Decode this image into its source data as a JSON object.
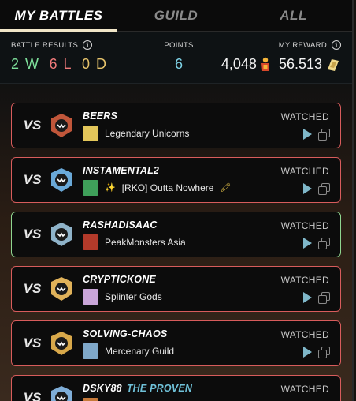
{
  "tabs": [
    {
      "label": "MY BATTLES",
      "active": true
    },
    {
      "label": "GUILD",
      "active": false
    },
    {
      "label": "ALL",
      "active": false
    }
  ],
  "stats": {
    "results_label": "BATTLE RESULTS",
    "wins": "2 W",
    "losses": "6 L",
    "draws": "0 D",
    "points_label": "POINTS",
    "points_value": "6",
    "reward_label": "MY REWARD",
    "dec_value": "4,048",
    "sps_value": "56.513"
  },
  "battles": [
    {
      "vs": "VS",
      "player": "BEERS",
      "title": "",
      "guild": "Legendary Unicorns",
      "guild_prefix": "",
      "guild_suffix": "",
      "status": "WATCHED",
      "result": "loss",
      "avatar_color": "#c0563a",
      "crest_color": "#e3c65a"
    },
    {
      "vs": "VS",
      "player": "INSTAMENTAL2",
      "title": "",
      "guild": "[RKO] Outta Nowhere",
      "guild_prefix": "✨",
      "guild_suffix": "🖍",
      "status": "WATCHED",
      "result": "loss",
      "avatar_color": "#6aa9d8",
      "crest_color": "#3fa05a"
    },
    {
      "vs": "VS",
      "player": "RASHADISAAC",
      "title": "",
      "guild": "PeakMonsters Asia",
      "guild_prefix": "",
      "guild_suffix": "",
      "status": "WATCHED",
      "result": "win",
      "avatar_color": "#8fb3c9",
      "crest_color": "#b33a2a"
    },
    {
      "vs": "VS",
      "player": "CRYPTICKONE",
      "title": "",
      "guild": "Splinter Gods",
      "guild_prefix": "",
      "guild_suffix": "",
      "status": "WATCHED",
      "result": "loss",
      "avatar_color": "#e0b25a",
      "crest_color": "#c9a5d8"
    },
    {
      "vs": "VS",
      "player": "SOLVING-CHAOS",
      "title": "",
      "guild": "Mercenary Guild",
      "guild_prefix": "",
      "guild_suffix": "",
      "status": "WATCHED",
      "result": "loss",
      "avatar_color": "#d8a84a",
      "crest_color": "#7fa8c9"
    },
    {
      "vs": "VS",
      "player": "DSKY88",
      "title": "THE PROVEN",
      "guild": "",
      "guild_prefix": "",
      "guild_suffix": "",
      "status": "WATCHED",
      "result": "loss",
      "avatar_color": "#7faed8",
      "crest_color": "#c77a3a"
    }
  ],
  "colors": {
    "win_border": "#8fd58f",
    "loss_border": "#d85c5c",
    "accent": "#f1e6c8"
  }
}
